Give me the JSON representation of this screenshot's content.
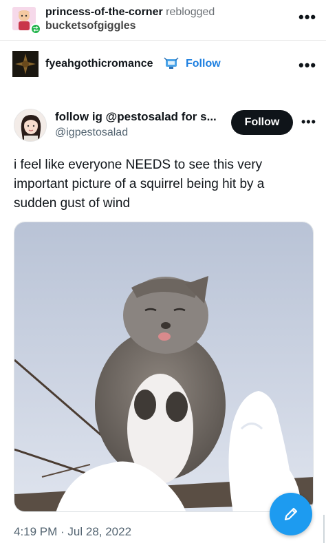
{
  "reblog": {
    "user": "princess-of-the-corner",
    "verb": "reblogged",
    "source": "bucketsofgiggles"
  },
  "post": {
    "author": "fyeahgothicromance",
    "follow_label": "Follow"
  },
  "tweet": {
    "display_name": "follow ig @pestosalad for s...",
    "handle": "@igpestosalad",
    "follow_label": "Follow",
    "text": "i feel like everyone NEEDS to see this very important picture of a squirrel being hit by a sudden gust of wind",
    "timestamp": "4:19 PM · Jul 28, 2022"
  },
  "icons": {
    "more": "more-dots-icon",
    "reblog": "reblog-icon",
    "compose": "pencil-icon"
  },
  "colors": {
    "accent": "#1d9bf0",
    "follow_link": "#1d7fe0",
    "follow_button": "#0f1419",
    "reblog_badge": "#23b44c"
  }
}
